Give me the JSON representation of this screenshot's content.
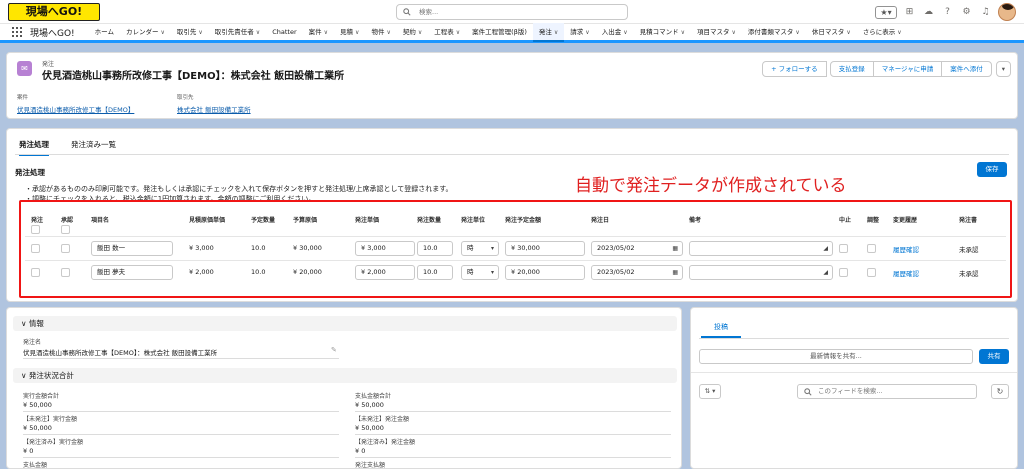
{
  "app": {
    "logo": "現場へGO!",
    "search_placeholder": "検索...",
    "app_name": "現場へGO!"
  },
  "nav": [
    {
      "label": "ホーム",
      "chev": false
    },
    {
      "label": "カレンダー",
      "chev": true
    },
    {
      "label": "取引先",
      "chev": true
    },
    {
      "label": "取引先責任者",
      "chev": true
    },
    {
      "label": "Chatter",
      "chev": false
    },
    {
      "label": "案件",
      "chev": true
    },
    {
      "label": "見積",
      "chev": true
    },
    {
      "label": "物件",
      "chev": true
    },
    {
      "label": "契約",
      "chev": true
    },
    {
      "label": "工程表",
      "chev": true
    },
    {
      "label": "案件工程管理(β版)",
      "chev": false
    },
    {
      "label": "発注",
      "chev": true,
      "active": true
    },
    {
      "label": "請求",
      "chev": true
    },
    {
      "label": "入出金",
      "chev": true
    },
    {
      "label": "見積コマンド",
      "chev": true
    },
    {
      "label": "項目マスタ",
      "chev": true
    },
    {
      "label": "添付書類マスタ",
      "chev": true
    },
    {
      "label": "休日マスタ",
      "chev": true
    },
    {
      "label": "さらに表示",
      "chev": true
    }
  ],
  "header": {
    "object_label": "発注",
    "title": "伏見酒造桃山事務所改修工事【DEMO】：株式会社 飯田設備工業所",
    "buttons": {
      "follow": "+ フォローする",
      "pay": "支払登録",
      "apply": "マネージャに申請",
      "attach": "案件へ添付",
      "more": "▾"
    },
    "fields": [
      {
        "label": "案件",
        "value": "伏見酒造桃山事務所改修工事【DEMO】"
      },
      {
        "label": "取引先",
        "value": "株式会社 飯田設備工業所"
      }
    ]
  },
  "main": {
    "tabs": [
      "発注処理",
      "発注済み一覧"
    ],
    "section_title": "発注処理",
    "save_label": "保存",
    "notes": [
      "・承認があるもののみ印刷可能です。発注もしくは承認にチェックを入れて保存ボタンを押すと発注処理/上席承認として登録されます。",
      "・調整にチェックを入れると、税込金額に1円加算されます。金額の調整にご利用ください。"
    ],
    "annotation": "自動で発注データが作成されている",
    "columns": {
      "order": "発注",
      "approve": "承認",
      "item": "項目名",
      "est_price": "見積原価単価",
      "qty_plan": "予定数量",
      "cost_plan": "予算原価",
      "unit_price": "発注単価",
      "order_qty": "発注数量",
      "unit": "発注単位",
      "order_amount": "発注予定金額",
      "order_date": "発注日",
      "remarks": "備考",
      "stop": "中止",
      "adjust": "調整",
      "history": "変更履歴",
      "doc": "発注書"
    },
    "rows": [
      {
        "item": "飯田 数一",
        "est_price": "¥ 3,000",
        "qty_plan": "10.0",
        "cost_plan": "¥ 30,000",
        "unit_price": "¥ 3,000",
        "order_qty": "10.0",
        "unit": "時",
        "order_amount": "¥ 30,000",
        "order_date": "2023/05/02",
        "history": "履歴確認",
        "doc": "未承認"
      },
      {
        "item": "飯田 夢夫",
        "est_price": "¥ 2,000",
        "qty_plan": "10.0",
        "cost_plan": "¥ 20,000",
        "unit_price": "¥ 2,000",
        "order_qty": "10.0",
        "unit": "時",
        "order_amount": "¥ 20,000",
        "order_date": "2023/05/02",
        "history": "履歴確認",
        "doc": "未承認"
      }
    ]
  },
  "info": {
    "section1": "情報",
    "name_label": "発注名",
    "name_value": "伏見酒造桃山事務所改修工事【DEMO】：株式会社 飯田設備工業所",
    "section2": "発注状況合計",
    "totals": [
      {
        "label": "実行金額合計",
        "value": "¥ 50,000"
      },
      {
        "label": "支払金額合計",
        "value": "¥ 50,000"
      },
      {
        "label": "【未発注】実行金額",
        "value": "¥ 50,000"
      },
      {
        "label": "【未発注】発注金額",
        "value": "¥ 50,000"
      },
      {
        "label": "【発注済み】実行金額",
        "value": "¥ 0"
      },
      {
        "label": "【発注済み】発注金額",
        "value": "¥ 0"
      },
      {
        "label": "支払金額",
        "value": ""
      },
      {
        "label": "発注支払額",
        "value": ""
      }
    ]
  },
  "feed": {
    "tab": "投稿",
    "share_placeholder": "最新情報を共有...",
    "share_button": "共有",
    "sort": "⇅ ▾",
    "search_placeholder": "このフィードを検索...",
    "refresh": "↻"
  }
}
